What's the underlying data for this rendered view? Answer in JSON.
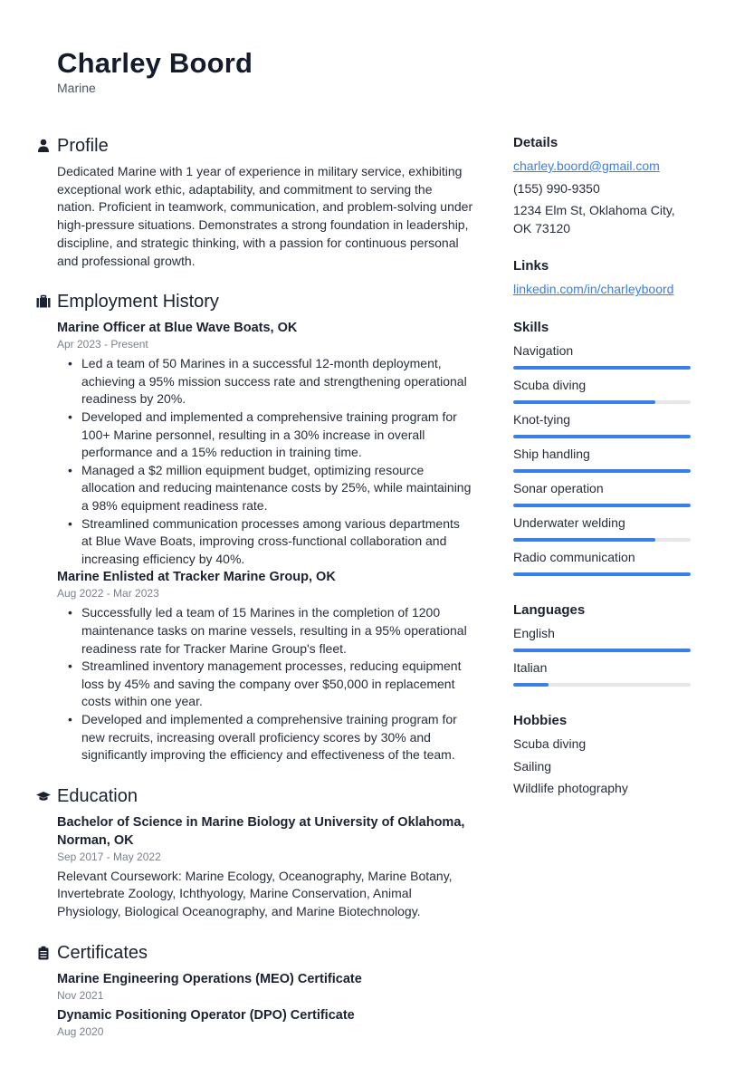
{
  "header": {
    "name": "Charley Boord",
    "title": "Marine"
  },
  "profile": {
    "heading": "Profile",
    "icon": "person-icon",
    "text": "Dedicated Marine with 1 year of experience in military service, exhibiting exceptional work ethic, adaptability, and commitment to serving the nation. Proficient in teamwork, communication, and problem-solving under high-pressure situations. Demonstrates a strong foundation in leadership, discipline, and strategic thinking, with a passion for continuous personal and professional growth."
  },
  "employment": {
    "heading": "Employment History",
    "icon": "briefcase-icon",
    "jobs": [
      {
        "title": "Marine Officer at Blue Wave Boats, OK",
        "date": "Apr 2023 - Present",
        "bullets": [
          "Led a team of 50 Marines in a successful 12-month deployment, achieving a 95% mission success rate and strengthening operational readiness by 20%.",
          "Developed and implemented a comprehensive training program for 100+ Marine personnel, resulting in a 30% increase in overall performance and a 15% reduction in training time.",
          "Managed a $2 million equipment budget, optimizing resource allocation and reducing maintenance costs by 25%, while maintaining a 98% equipment readiness rate.",
          "Streamlined communication processes among various departments at Blue Wave Boats, improving cross-functional collaboration and increasing efficiency by 40%."
        ]
      },
      {
        "title": "Marine Enlisted at Tracker Marine Group, OK",
        "date": "Aug 2022 - Mar 2023",
        "bullets": [
          "Successfully led a team of 15 Marines in the completion of 1200 maintenance tasks on marine vessels, resulting in a 95% operational readiness rate for Tracker Marine Group's fleet.",
          "Streamlined inventory management processes, reducing equipment loss by 45% and saving the company over $50,000 in replacement costs within one year.",
          "Developed and implemented a comprehensive training program for new recruits, increasing overall proficiency scores by 30% and significantly improving the efficiency and effectiveness of the team."
        ]
      }
    ]
  },
  "education": {
    "heading": "Education",
    "icon": "graduation-cap-icon",
    "items": [
      {
        "title": "Bachelor of Science in Marine Biology at University of Oklahoma, Norman, OK",
        "date": "Sep 2017 - May 2022",
        "text": "Relevant Coursework: Marine Ecology, Oceanography, Marine Botany, Invertebrate Zoology, Ichthyology, Marine Conservation, Animal Physiology, Biological Oceanography, and Marine Biotechnology."
      }
    ]
  },
  "certificates": {
    "heading": "Certificates",
    "icon": "clipboard-icon",
    "items": [
      {
        "title": "Marine Engineering Operations (MEO) Certificate",
        "date": "Nov 2021"
      },
      {
        "title": "Dynamic Positioning Operator (DPO) Certificate",
        "date": "Aug 2020"
      }
    ]
  },
  "details": {
    "heading": "Details",
    "email": "charley.boord@gmail.com",
    "phone": "(155) 990-9350",
    "address": "1234 Elm St, Oklahoma City, OK 73120"
  },
  "links": {
    "heading": "Links",
    "items": [
      "linkedin.com/in/charleyboord"
    ]
  },
  "skills": {
    "heading": "Skills",
    "items": [
      {
        "label": "Navigation",
        "level": 100
      },
      {
        "label": "Scuba diving",
        "level": 80
      },
      {
        "label": "Knot-tying",
        "level": 100
      },
      {
        "label": "Ship handling",
        "level": 100
      },
      {
        "label": "Sonar operation",
        "level": 100
      },
      {
        "label": "Underwater welding",
        "level": 80
      },
      {
        "label": "Radio communication",
        "level": 100
      }
    ]
  },
  "languages": {
    "heading": "Languages",
    "items": [
      {
        "label": "English",
        "level": 100
      },
      {
        "label": "Italian",
        "level": 20
      }
    ]
  },
  "hobbies": {
    "heading": "Hobbies",
    "items": [
      "Scuba diving",
      "Sailing",
      "Wildlife photography"
    ]
  },
  "colors": {
    "accent": "#3a7ee8",
    "track": "#e4e6ea",
    "text": "#1e2532",
    "muted": "#7b818c"
  }
}
